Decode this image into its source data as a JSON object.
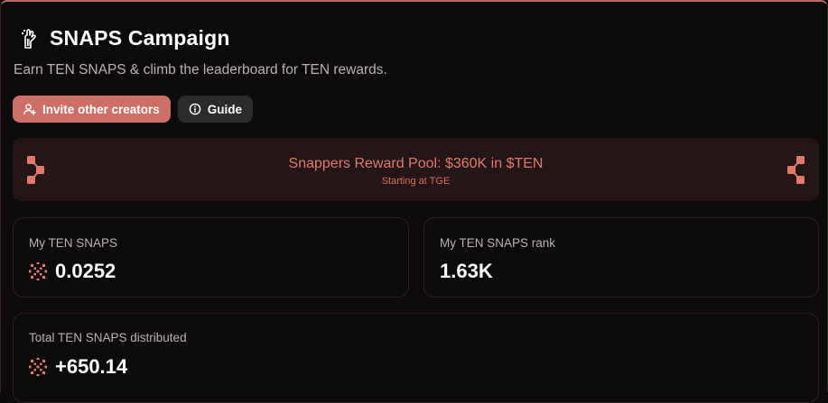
{
  "header": {
    "title": "SNAPS Campaign",
    "logo_icon": "hand-logo-icon",
    "subtitle": "Earn TEN SNAPS & climb the leaderboard for TEN rewards."
  },
  "actions": {
    "invite_label": "Invite other creators",
    "invite_icon": "add-user-icon",
    "guide_label": "Guide",
    "guide_icon": "info-icon"
  },
  "reward_pool": {
    "title": "Snappers Reward Pool: $360K in $TEN",
    "subtitle": "Starting at TGE"
  },
  "stats": {
    "my_snaps": {
      "label": "My TEN SNAPS",
      "value": "0.0252",
      "icon": "snaps-icon"
    },
    "my_rank": {
      "label": "My TEN SNAPS rank",
      "value": "1.63K"
    },
    "total_distributed": {
      "label": "Total TEN SNAPS distributed",
      "value": "+650.14",
      "icon": "snaps-icon"
    }
  },
  "colors": {
    "accent": "#cd6f66",
    "pool_text": "#e2796d",
    "pool_bg": "#241616",
    "background": "#0c0a0a"
  }
}
